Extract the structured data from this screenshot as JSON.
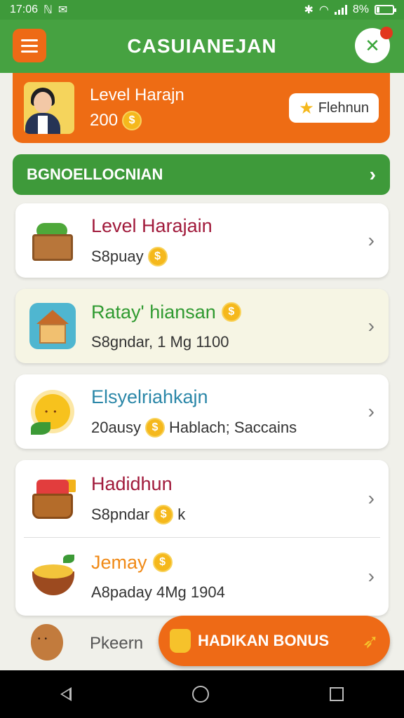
{
  "status_bar": {
    "time": "17:06",
    "icons_left": [
      "nfc-icon",
      "mail-icon"
    ],
    "battery": "8%"
  },
  "app_bar": {
    "title": "CASUIANEJAN"
  },
  "profile": {
    "name": "Level Harajn",
    "points": "200",
    "premium_label": "Flehnun"
  },
  "section": {
    "label": "BGNOELLOCNIAN"
  },
  "list": [
    {
      "title": "Level Harajain",
      "subtitle": "S8puay",
      "icon": "vegetable-crate-icon",
      "title_color": "#a11a3b"
    },
    {
      "title": "Ratay' hiansan",
      "subtitle": "S8gndar, 1 Mg 1100",
      "icon": "house-icon",
      "title_color": "#2f9a30"
    },
    {
      "title": "Elsyelriahkajn",
      "subtitle": "20ausy",
      "subtitle_extra": "Hablach; Saccains",
      "icon": "sun-icon",
      "title_color": "#2b87a8"
    },
    {
      "title": "Hadidhun",
      "subtitle": "S8pndar",
      "subtitle_extra": "k",
      "icon": "gift-basket-icon",
      "title_color": "#a11a3b"
    },
    {
      "title": "Jemay",
      "subtitle": "A8paday 4Mg 1904",
      "icon": "soup-bowl-icon",
      "title_color": "#f08a17"
    }
  ],
  "partial_item": {
    "title": "Pkeern"
  },
  "bonus_button": {
    "label": "HADIKAN BONUS"
  },
  "coin_symbol": "$"
}
